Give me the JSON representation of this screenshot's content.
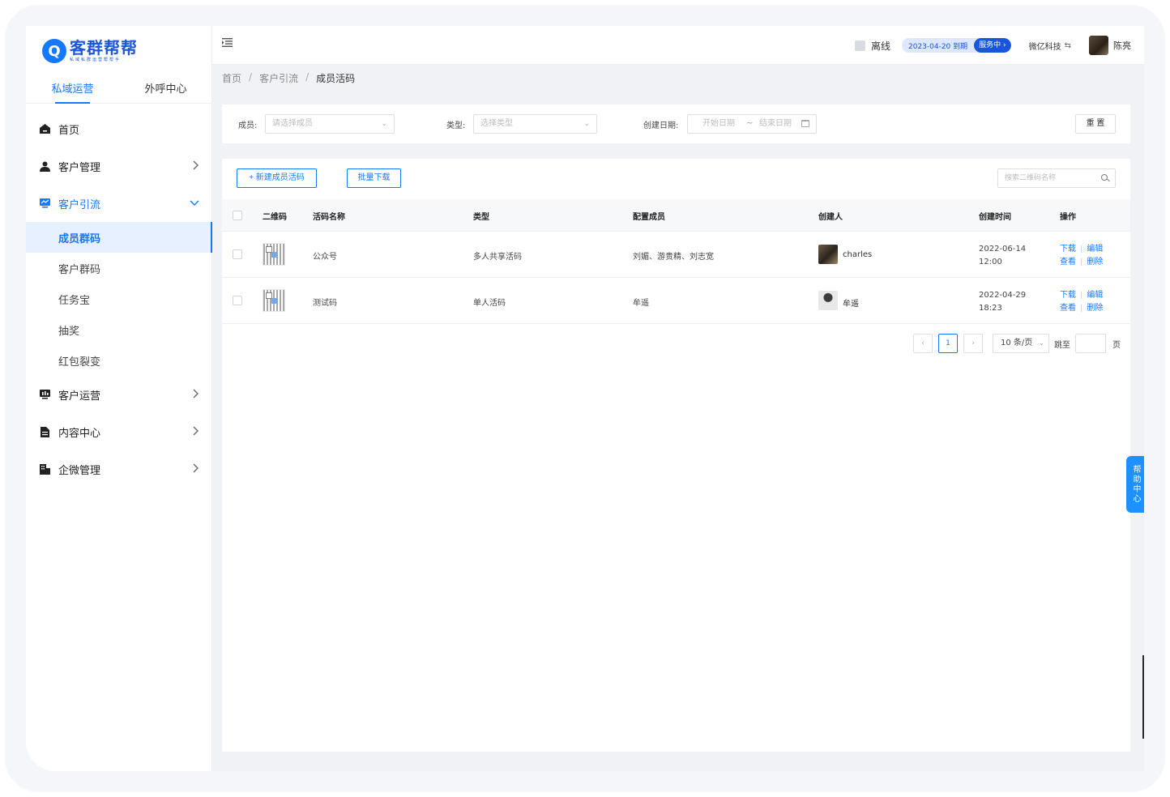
{
  "app": {
    "logo_mark": "Q",
    "logo_title": "客群帮帮",
    "logo_subtitle": "私域私群运营帮帮手"
  },
  "top_tabs": [
    {
      "label": "私域运营",
      "active": true
    },
    {
      "label": "外呼中心",
      "active": false
    }
  ],
  "menu": {
    "home": "首页",
    "customer_mgmt": "客户管理",
    "customer_acq": "客户引流",
    "sub": [
      "成员群码",
      "客户群码",
      "任务宝",
      "抽奖",
      "红包裂变"
    ],
    "customer_ops": "客户运营",
    "content_center": "内容中心",
    "wecom_mgmt": "企微管理"
  },
  "header": {
    "status": "离线",
    "expiry_date": "2023-04-20 到期",
    "service_btn": "服务中 ›",
    "company": "微亿科技",
    "swap_icon": "⇆",
    "user_name": "陈亮"
  },
  "breadcrumb": [
    "首页",
    "客户引流",
    "成员活码"
  ],
  "filters": {
    "member_label": "成员:",
    "member_placeholder": "请选择成员",
    "type_label": "类型:",
    "type_placeholder": "选择类型",
    "date_label": "创建日期:",
    "date_start": "开始日期",
    "date_sep": "~",
    "date_end": "结束日期",
    "reset": "重 置"
  },
  "toolbar": {
    "new_button": "+ 新建成员活码",
    "batch_download": "批量下载",
    "search_placeholder": "搜索二维码名称"
  },
  "table": {
    "columns": [
      "二维码",
      "活码名称",
      "类型",
      "配置成员",
      "创建人",
      "创建时间",
      "操作"
    ],
    "rows": [
      {
        "name": "公众号",
        "type": "多人共享活码",
        "members": "刘媚、游贵精、刘志宽",
        "creator": "charles",
        "date": "2022-06-14",
        "time": "12:00"
      },
      {
        "name": "测试码",
        "type": "单人活码",
        "members": "牟遥",
        "creator": "牟遥",
        "date": "2022-04-29",
        "time": "18:23"
      }
    ],
    "actions": {
      "download": "下载",
      "edit": "编辑",
      "view": "查看",
      "delete": "删除"
    }
  },
  "pagination": {
    "prev": "‹",
    "current": "1",
    "next": "›",
    "page_size": "10 条/页",
    "jump_label": "跳至",
    "page_unit": "页"
  },
  "help_tab": "帮助中心",
  "colors": {
    "primary": "#1677ff",
    "active_bg": "#e6f0ff"
  }
}
